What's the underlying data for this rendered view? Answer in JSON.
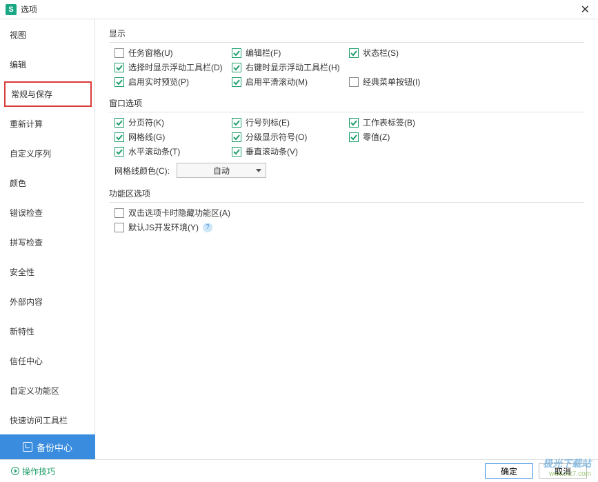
{
  "window": {
    "title": "选项"
  },
  "sidebar": {
    "items": [
      "视图",
      "编辑",
      "常规与保存",
      "重新计算",
      "自定义序列",
      "颜色",
      "错误检查",
      "拼写检查",
      "安全性",
      "外部内容",
      "新特性",
      "信任中心",
      "自定义功能区",
      "快速访问工具栏"
    ],
    "backup": "备份中心"
  },
  "sections": {
    "display": {
      "title": "显示",
      "items": {
        "task_pane": {
          "label": "任务窗格(U)",
          "checked": false
        },
        "formula_bar": {
          "label": "编辑栏(F)",
          "checked": true
        },
        "status_bar": {
          "label": "状态栏(S)",
          "checked": true
        },
        "sel_toolbar": {
          "label": "选择时显示浮动工具栏(D)",
          "checked": true
        },
        "rc_toolbar": {
          "label": "右键时显示浮动工具栏(H)",
          "checked": true
        },
        "live_prev": {
          "label": "启用实时预览(P)",
          "checked": true
        },
        "smooth_scr": {
          "label": "启用平滑滚动(M)",
          "checked": true
        },
        "classic_menu": {
          "label": "经典菜单按钮(I)",
          "checked": false
        }
      }
    },
    "window": {
      "title": "窗口选项",
      "items": {
        "page_break": {
          "label": "分页符(K)",
          "checked": true
        },
        "row_col_hdr": {
          "label": "行号列标(E)",
          "checked": true
        },
        "sheet_tab": {
          "label": "工作表标签(B)",
          "checked": true
        },
        "gridlines": {
          "label": "网格线(G)",
          "checked": true
        },
        "outline": {
          "label": "分级显示符号(O)",
          "checked": true
        },
        "zero_val": {
          "label": "零值(Z)",
          "checked": true
        },
        "hscroll": {
          "label": "水平滚动条(T)",
          "checked": true
        },
        "vscroll": {
          "label": "垂直滚动条(V)",
          "checked": true
        }
      },
      "grid_color_label": "网格线颜色(C):",
      "grid_color_value": "自动"
    },
    "ribbon": {
      "title": "功能区选项",
      "items": {
        "dblclick_hide": {
          "label": "双击选项卡时隐藏功能区(A)",
          "checked": false
        },
        "js_dev": {
          "label": "默认JS开发环境(Y)",
          "checked": false
        }
      }
    }
  },
  "footer": {
    "tips": "操作技巧",
    "ok": "确定",
    "cancel": "取消"
  },
  "watermark": {
    "line1": "极光下载站",
    "line2": "www.xz7.com"
  }
}
